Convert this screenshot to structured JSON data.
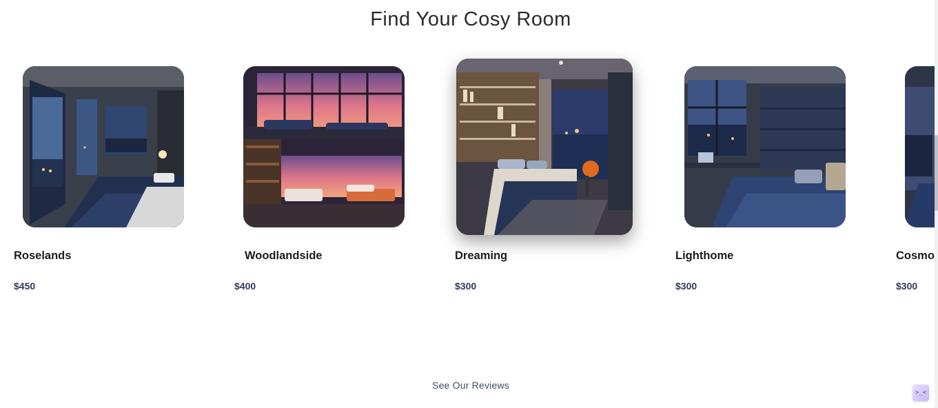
{
  "page": {
    "title": "Find Your Cosy Room",
    "reviews_link": "See Our Reviews"
  },
  "rooms": [
    {
      "name": "Roselands",
      "price": "$450"
    },
    {
      "name": "Woodlandside",
      "price": "$400"
    },
    {
      "name": "Dreaming",
      "price": "$300",
      "featured": true
    },
    {
      "name": "Lighthome",
      "price": "$300"
    },
    {
      "name": "Cosmo'",
      "price": "$300"
    }
  ],
  "chat_widget": {
    "icon": "chat-bubble-icon",
    "glyph": ">_<"
  },
  "colors": {
    "price_text": "#2f3a5a",
    "link_text": "#3d4b66"
  }
}
